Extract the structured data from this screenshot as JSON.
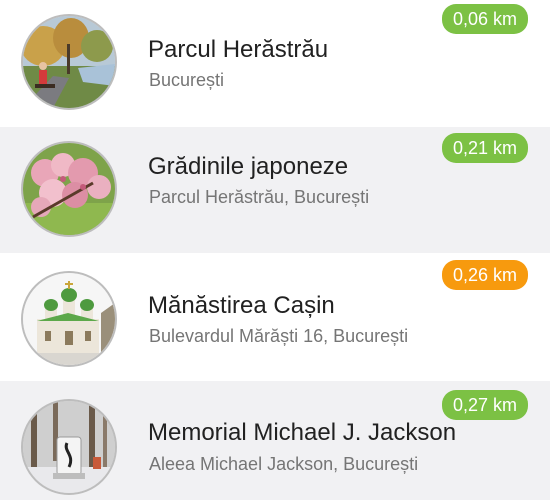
{
  "colors": {
    "near": "#7cc144",
    "medium": "#f79a0e"
  },
  "places": [
    {
      "name": "Parcul Herăstrău",
      "address": "București",
      "distance": "0,06 km",
      "badge_color": "#7cc144",
      "thumb_icon": "park-photo"
    },
    {
      "name": "Grădinile japoneze",
      "address": "Parcul Herăstrău, București",
      "distance": "0,21 km",
      "badge_color": "#7cc144",
      "thumb_icon": "cherry-blossom-photo"
    },
    {
      "name": "Mănăstirea Cașin",
      "address": "Bulevardul Mărăști 16, București",
      "distance": "0,26 km",
      "badge_color": "#f79a0e",
      "thumb_icon": "monastery-photo"
    },
    {
      "name": "Memorial Michael J. Jackson",
      "address": "Aleea Michael Jackson, București",
      "distance": "0,27 km",
      "badge_color": "#7cc144",
      "thumb_icon": "memorial-photo"
    }
  ]
}
